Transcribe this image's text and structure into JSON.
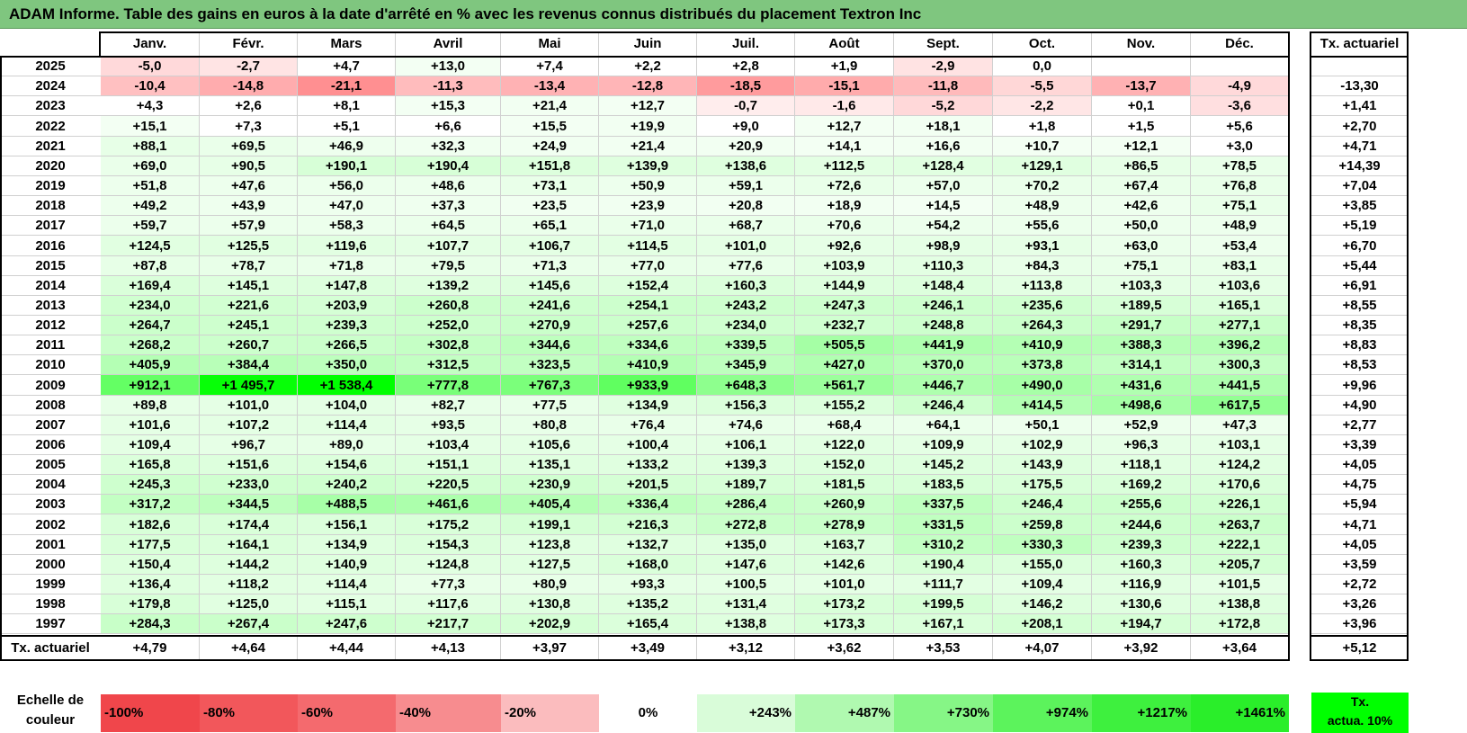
{
  "title": "ADAM Informe. Table des gains en euros à la date d'arrêté en % avec les revenus connus distribués du placement Textron Inc",
  "months": [
    "Janv.",
    "Févr.",
    "Mars",
    "Avril",
    "Mai",
    "Juin",
    "Juil.",
    "Août",
    "Sept.",
    "Oct.",
    "Nov.",
    "Déc."
  ],
  "tx_header": "Tx. actuariel",
  "rows": [
    {
      "year": "2025",
      "values": [
        "-5,0",
        "-2,7",
        "+4,7",
        "+13,0",
        "+7,4",
        "+2,2",
        "+2,8",
        "+1,9",
        "-2,9",
        "0,0",
        "",
        ""
      ],
      "tx": ""
    },
    {
      "year": "2024",
      "values": [
        "-10,4",
        "-14,8",
        "-21,1",
        "-11,3",
        "-13,4",
        "-12,8",
        "-18,5",
        "-15,1",
        "-11,8",
        "-5,5",
        "-13,7",
        "-4,9"
      ],
      "tx": "-13,30"
    },
    {
      "year": "2023",
      "values": [
        "+4,3",
        "+2,6",
        "+8,1",
        "+15,3",
        "+21,4",
        "+12,7",
        "-0,7",
        "-1,6",
        "-5,2",
        "-2,2",
        "+0,1",
        "-3,6"
      ],
      "tx": "+1,41"
    },
    {
      "year": "2022",
      "values": [
        "+15,1",
        "+7,3",
        "+5,1",
        "+6,6",
        "+15,5",
        "+19,9",
        "+9,0",
        "+12,7",
        "+18,1",
        "+1,8",
        "+1,5",
        "+5,6"
      ],
      "tx": "+2,70"
    },
    {
      "year": "2021",
      "values": [
        "+88,1",
        "+69,5",
        "+46,9",
        "+32,3",
        "+24,9",
        "+21,4",
        "+20,9",
        "+14,1",
        "+16,6",
        "+10,7",
        "+12,1",
        "+3,0"
      ],
      "tx": "+4,71"
    },
    {
      "year": "2020",
      "values": [
        "+69,0",
        "+90,5",
        "+190,1",
        "+190,4",
        "+151,8",
        "+139,9",
        "+138,6",
        "+112,5",
        "+128,4",
        "+129,1",
        "+86,5",
        "+78,5"
      ],
      "tx": "+14,39"
    },
    {
      "year": "2019",
      "values": [
        "+51,8",
        "+47,6",
        "+56,0",
        "+48,6",
        "+73,1",
        "+50,9",
        "+59,1",
        "+72,6",
        "+57,0",
        "+70,2",
        "+67,4",
        "+76,8"
      ],
      "tx": "+7,04"
    },
    {
      "year": "2018",
      "values": [
        "+49,2",
        "+43,9",
        "+47,0",
        "+37,3",
        "+23,5",
        "+23,9",
        "+20,8",
        "+18,9",
        "+14,5",
        "+48,9",
        "+42,6",
        "+75,1"
      ],
      "tx": "+3,85"
    },
    {
      "year": "2017",
      "values": [
        "+59,7",
        "+57,9",
        "+58,3",
        "+64,5",
        "+65,1",
        "+71,0",
        "+68,7",
        "+70,6",
        "+54,2",
        "+55,6",
        "+50,0",
        "+48,9"
      ],
      "tx": "+5,19"
    },
    {
      "year": "2016",
      "values": [
        "+124,5",
        "+125,5",
        "+119,6",
        "+107,7",
        "+106,7",
        "+114,5",
        "+101,0",
        "+92,6",
        "+98,9",
        "+93,1",
        "+63,0",
        "+53,4"
      ],
      "tx": "+6,70"
    },
    {
      "year": "2015",
      "values": [
        "+87,8",
        "+78,7",
        "+71,8",
        "+79,5",
        "+71,3",
        "+77,0",
        "+77,6",
        "+103,9",
        "+110,3",
        "+84,3",
        "+75,1",
        "+83,1"
      ],
      "tx": "+5,44"
    },
    {
      "year": "2014",
      "values": [
        "+169,4",
        "+145,1",
        "+147,8",
        "+139,2",
        "+145,6",
        "+152,4",
        "+160,3",
        "+144,9",
        "+148,4",
        "+113,8",
        "+103,3",
        "+103,6"
      ],
      "tx": "+6,91"
    },
    {
      "year": "2013",
      "values": [
        "+234,0",
        "+221,6",
        "+203,9",
        "+260,8",
        "+241,6",
        "+254,1",
        "+243,2",
        "+247,3",
        "+246,1",
        "+235,6",
        "+189,5",
        "+165,1"
      ],
      "tx": "+8,55"
    },
    {
      "year": "2012",
      "values": [
        "+264,7",
        "+245,1",
        "+239,3",
        "+252,0",
        "+270,9",
        "+257,6",
        "+234,0",
        "+232,7",
        "+248,8",
        "+264,3",
        "+291,7",
        "+277,1"
      ],
      "tx": "+8,35"
    },
    {
      "year": "2011",
      "values": [
        "+268,2",
        "+260,7",
        "+266,5",
        "+302,8",
        "+344,6",
        "+334,6",
        "+339,5",
        "+505,5",
        "+441,9",
        "+410,9",
        "+388,3",
        "+396,2"
      ],
      "tx": "+8,83"
    },
    {
      "year": "2010",
      "values": [
        "+405,9",
        "+384,4",
        "+350,0",
        "+312,5",
        "+323,5",
        "+410,9",
        "+345,9",
        "+427,0",
        "+370,0",
        "+373,8",
        "+314,1",
        "+300,3"
      ],
      "tx": "+8,53"
    },
    {
      "year": "2009",
      "values": [
        "+912,1",
        "+1 495,7",
        "+1 538,4",
        "+777,8",
        "+767,3",
        "+933,9",
        "+648,3",
        "+561,7",
        "+446,7",
        "+490,0",
        "+431,6",
        "+441,5"
      ],
      "tx": "+9,96"
    },
    {
      "year": "2008",
      "values": [
        "+89,8",
        "+101,0",
        "+104,0",
        "+82,7",
        "+77,5",
        "+134,9",
        "+156,3",
        "+155,2",
        "+246,4",
        "+414,5",
        "+498,6",
        "+617,5"
      ],
      "tx": "+4,90"
    },
    {
      "year": "2007",
      "values": [
        "+101,6",
        "+107,2",
        "+114,4",
        "+93,5",
        "+80,8",
        "+76,4",
        "+74,6",
        "+68,4",
        "+64,1",
        "+50,1",
        "+52,9",
        "+47,3"
      ],
      "tx": "+2,77"
    },
    {
      "year": "2006",
      "values": [
        "+109,4",
        "+96,7",
        "+89,0",
        "+103,4",
        "+105,6",
        "+100,4",
        "+106,1",
        "+122,0",
        "+109,9",
        "+102,9",
        "+96,3",
        "+103,1"
      ],
      "tx": "+3,39"
    },
    {
      "year": "2005",
      "values": [
        "+165,8",
        "+151,6",
        "+154,6",
        "+151,1",
        "+135,1",
        "+133,2",
        "+139,3",
        "+152,0",
        "+145,2",
        "+143,9",
        "+118,1",
        "+124,2"
      ],
      "tx": "+4,05"
    },
    {
      "year": "2004",
      "values": [
        "+245,3",
        "+233,0",
        "+240,2",
        "+220,5",
        "+230,9",
        "+201,5",
        "+189,7",
        "+181,5",
        "+183,5",
        "+175,5",
        "+169,2",
        "+170,6"
      ],
      "tx": "+4,75"
    },
    {
      "year": "2003",
      "values": [
        "+317,2",
        "+344,5",
        "+488,5",
        "+461,6",
        "+405,4",
        "+336,4",
        "+286,4",
        "+260,9",
        "+337,5",
        "+246,4",
        "+255,6",
        "+226,1"
      ],
      "tx": "+5,94"
    },
    {
      "year": "2002",
      "values": [
        "+182,6",
        "+174,4",
        "+156,1",
        "+175,2",
        "+199,1",
        "+216,3",
        "+272,8",
        "+278,9",
        "+331,5",
        "+259,8",
        "+244,6",
        "+263,7"
      ],
      "tx": "+4,71"
    },
    {
      "year": "2001",
      "values": [
        "+177,5",
        "+164,1",
        "+134,9",
        "+154,3",
        "+123,8",
        "+132,7",
        "+135,0",
        "+163,7",
        "+310,2",
        "+330,3",
        "+239,3",
        "+222,1"
      ],
      "tx": "+4,05"
    },
    {
      "year": "2000",
      "values": [
        "+150,4",
        "+144,2",
        "+140,9",
        "+124,8",
        "+127,5",
        "+168,0",
        "+147,6",
        "+142,6",
        "+190,4",
        "+155,0",
        "+160,3",
        "+205,7"
      ],
      "tx": "+3,59"
    },
    {
      "year": "1999",
      "values": [
        "+136,4",
        "+118,2",
        "+114,4",
        "+77,3",
        "+80,9",
        "+93,3",
        "+100,5",
        "+101,0",
        "+111,7",
        "+109,4",
        "+116,9",
        "+101,5"
      ],
      "tx": "+2,72"
    },
    {
      "year": "1998",
      "values": [
        "+179,8",
        "+125,0",
        "+115,1",
        "+117,6",
        "+130,8",
        "+135,2",
        "+131,4",
        "+173,2",
        "+199,5",
        "+146,2",
        "+130,6",
        "+138,8"
      ],
      "tx": "+3,26"
    },
    {
      "year": "1997",
      "values": [
        "+284,3",
        "+267,4",
        "+247,6",
        "+217,7",
        "+202,9",
        "+165,4",
        "+138,8",
        "+173,3",
        "+167,1",
        "+208,1",
        "+194,7",
        "+172,8"
      ],
      "tx": "+3,96"
    }
  ],
  "footer": {
    "label": "Tx. actuariel",
    "values": [
      "+4,79",
      "+4,64",
      "+4,44",
      "+4,13",
      "+3,97",
      "+3,49",
      "+3,12",
      "+3,62",
      "+3,53",
      "+4,07",
      "+3,92",
      "+3,64"
    ],
    "tx": "+5,12"
  },
  "legend": {
    "label_line1": "Echelle de",
    "label_line2": "couleur",
    "items": [
      {
        "text": "-100%",
        "color": "#f0464b",
        "align": "left"
      },
      {
        "text": "-80%",
        "color": "#f2575b",
        "align": "left"
      },
      {
        "text": "-60%",
        "color": "#f46a6e",
        "align": "left"
      },
      {
        "text": "-40%",
        "color": "#f78c8f",
        "align": "left"
      },
      {
        "text": "-20%",
        "color": "#fbbcbe",
        "align": "left"
      },
      {
        "text": "0%",
        "color": "#ffffff",
        "align": "center"
      },
      {
        "text": "+243%",
        "color": "#d9fcd9",
        "align": "right"
      },
      {
        "text": "+487%",
        "color": "#b0f9b0",
        "align": "right"
      },
      {
        "text": "+730%",
        "color": "#86f686",
        "align": "right"
      },
      {
        "text": "+974%",
        "color": "#5cf35c",
        "align": "right"
      },
      {
        "text": "+1217%",
        "color": "#3ef03e",
        "align": "right"
      },
      {
        "text": "+1461%",
        "color": "#2aee2a",
        "align": "right"
      }
    ],
    "actua_line1": "Tx.",
    "actua_line2": "actua. 10%",
    "actua_color": "#00ff00"
  },
  "colors": {
    "title_bg": "#7fc67f"
  }
}
